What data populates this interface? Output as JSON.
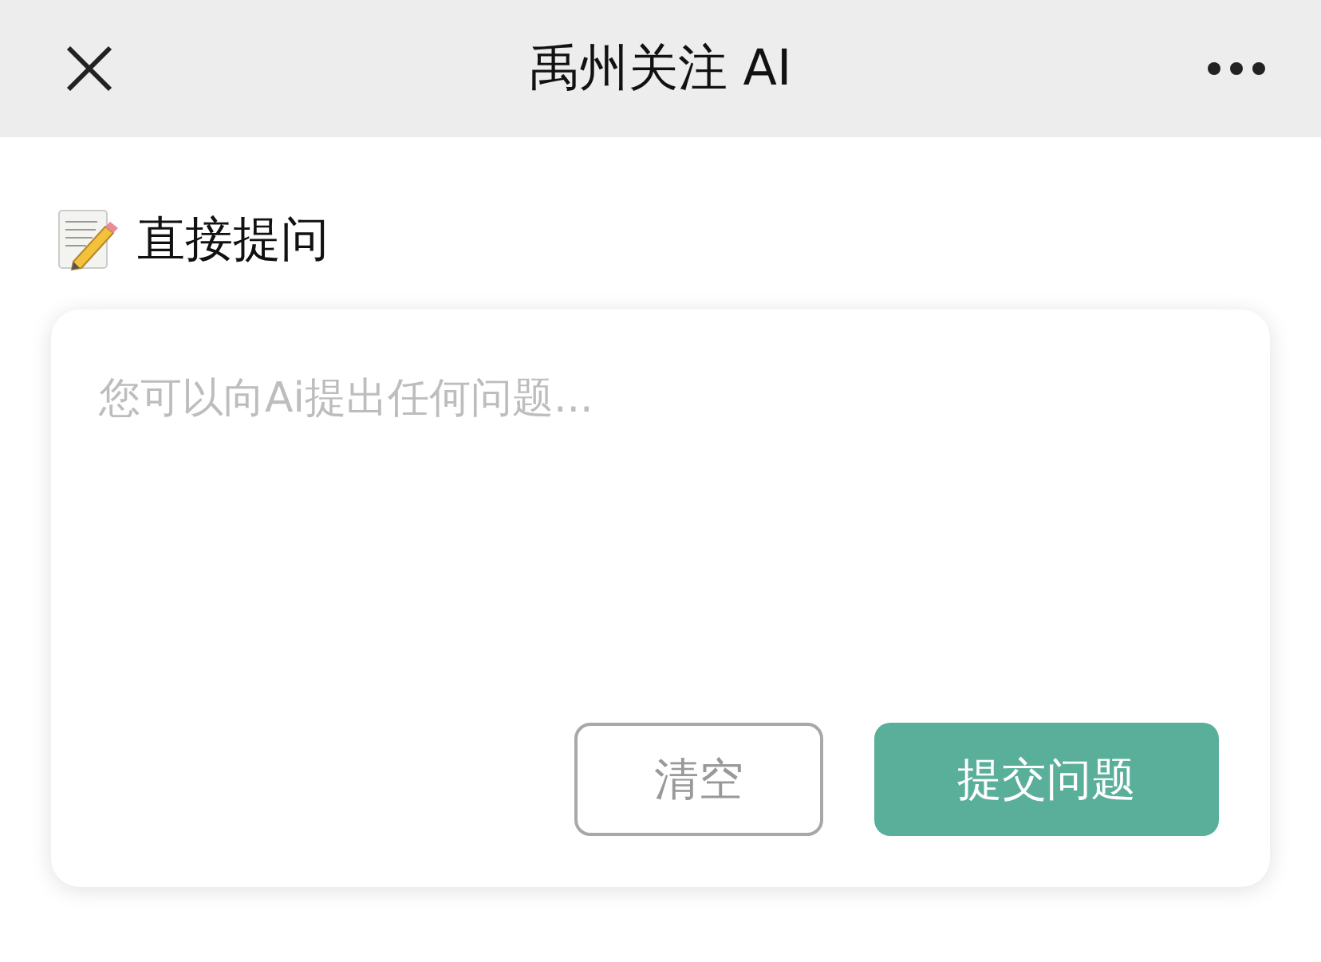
{
  "header": {
    "title": "禹州关注 AI"
  },
  "section": {
    "title": "直接提问"
  },
  "question": {
    "placeholder": "您可以向Ai提出任何问题..."
  },
  "buttons": [
    {
      "label": "清空",
      "kind": "outline"
    },
    {
      "label": "提交问题",
      "kind": "primary"
    }
  ]
}
